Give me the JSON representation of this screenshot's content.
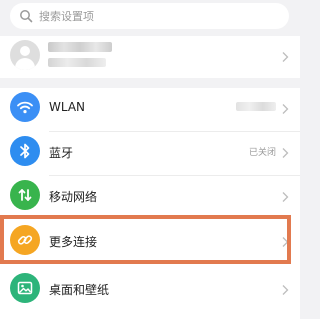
{
  "search": {
    "placeholder": "搜索设置项",
    "icon": "search-icon"
  },
  "account": {
    "icon": "avatar-icon"
  },
  "settings": [
    {
      "id": "wlan",
      "label": "WLAN",
      "icon": "wifi-icon",
      "color": "#3b8ff5"
    },
    {
      "id": "bluetooth",
      "label": "蓝牙",
      "value": "已关闭",
      "icon": "bluetooth-icon",
      "color": "#2e8df0"
    },
    {
      "id": "mobile-network",
      "label": "移动网络",
      "icon": "mobile-data-icon",
      "color": "#38b44d"
    },
    {
      "id": "more-connections",
      "label": "更多连接",
      "icon": "link-icon",
      "color": "#f5a623"
    },
    {
      "id": "home-wallpaper",
      "label": "桌面和壁纸",
      "icon": "image-icon",
      "color": "#2db47a"
    }
  ],
  "highlight_color": "#e27a4f"
}
